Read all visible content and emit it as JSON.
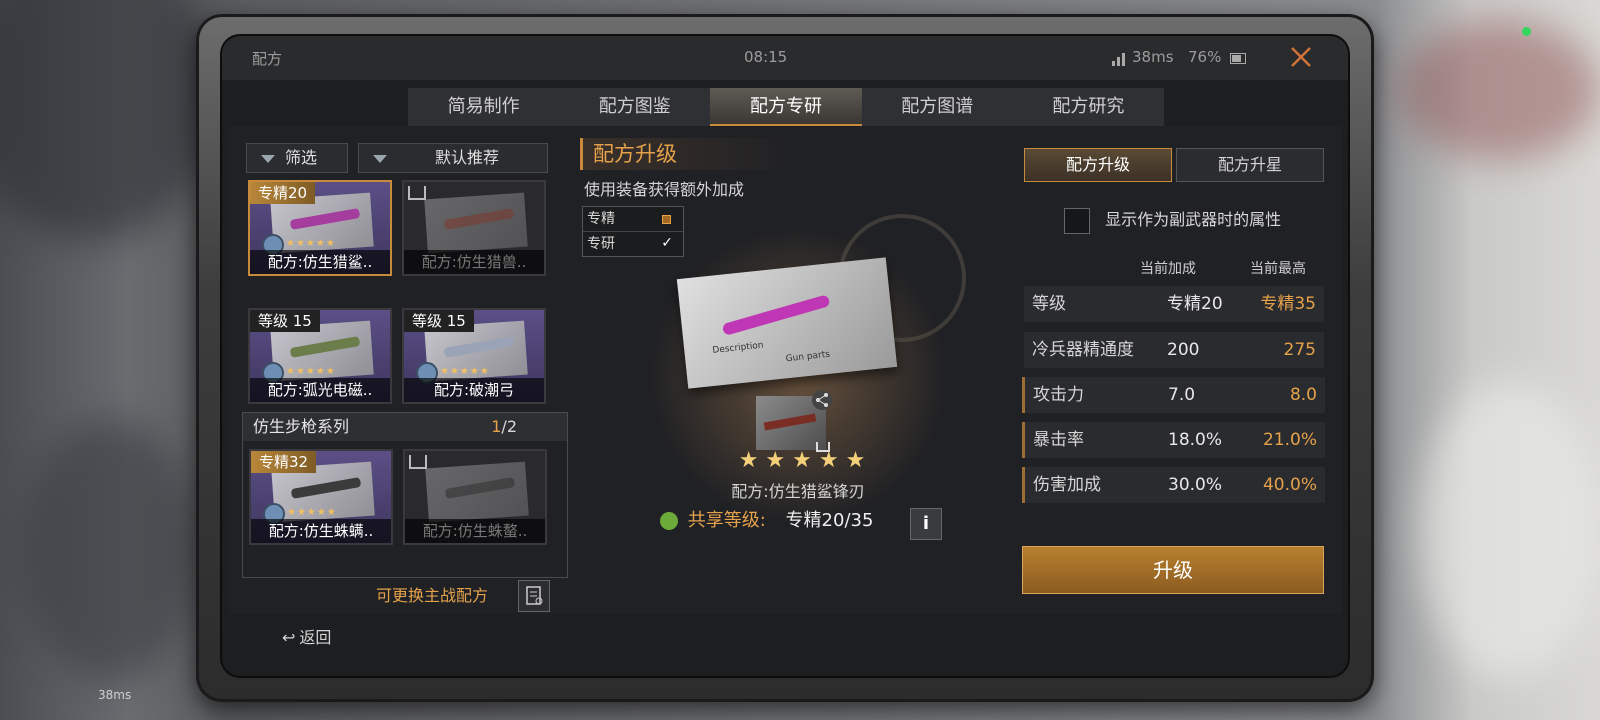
{
  "status": {
    "title": "配方",
    "time": "08:15",
    "ping": "38ms",
    "battery": "76%"
  },
  "tabs": [
    "简易制作",
    "配方图鉴",
    "配方专研",
    "配方图谱",
    "配方研究"
  ],
  "filters": {
    "filter": "筛选",
    "sort": "默认推荐"
  },
  "cards": [
    {
      "badge": "专精20",
      "label": "配方:仿生猎鲨..",
      "stars": "★★★★★"
    },
    {
      "label": "配方:仿生猎兽.."
    },
    {
      "badge": "等级 15",
      "label": "配方:弧光电磁..",
      "stars": "★★★★★"
    },
    {
      "badge": "等级 15",
      "label": "配方:破潮弓",
      "stars": "★★★★★"
    },
    {
      "badge": "专精32",
      "label": "配方:仿生蛛螨..",
      "stars": "★★★★★"
    },
    {
      "label": "配方:仿生蛛螯.."
    }
  ],
  "group": {
    "name": "仿生步枪系列",
    "count": "1",
    "total": "/2"
  },
  "swap_label": "可更换主战配方",
  "center": {
    "title": "配方升级",
    "subtitle": "使用装备获得额外加成",
    "checks": [
      "专精",
      "专研"
    ],
    "paper_texts": {
      "desc": "Description",
      "parts": "Gun parts"
    },
    "stars": "★ ★ ★ ★ ★",
    "item_name": "配方:仿生猎鲨锋刃",
    "share_label": "共享等级:",
    "share_value": "专精20/35",
    "info": "i"
  },
  "right": {
    "tab_upgrade": "配方升级",
    "tab_star": "配方升星",
    "secondary_check": "显示作为副武器时的属性",
    "col_current": "当前加成",
    "col_max": "当前最高",
    "rows": [
      {
        "name": "等级",
        "cur": "专精20",
        "max": "专精35"
      },
      {
        "name": "冷兵器精通度",
        "cur": "200",
        "max": "275"
      },
      {
        "name": "攻击力",
        "cur": "7.0",
        "max": "8.0"
      },
      {
        "name": "暴击率",
        "cur": "18.0%",
        "max": "21.0%"
      },
      {
        "name": "伤害加成",
        "cur": "30.0%",
        "max": "40.0%"
      }
    ],
    "upgrade_button": "升级"
  },
  "back": "返回",
  "bottom_status": "38ms"
}
